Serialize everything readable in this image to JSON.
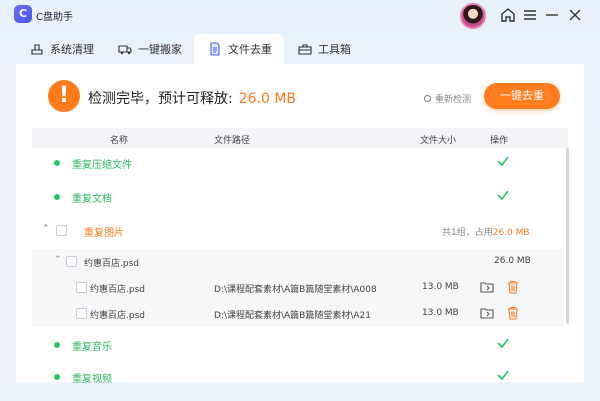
{
  "app": {
    "title": "C盘助手",
    "logo_letter": "C"
  },
  "window_controls": [
    "home-icon",
    "menu-icon",
    "minimize-icon",
    "close-icon"
  ],
  "tabs": [
    {
      "label": "系统清理",
      "icon": "broom-icon",
      "active": false
    },
    {
      "label": "一键搬家",
      "icon": "truck-icon",
      "active": false
    },
    {
      "label": "文件去重",
      "icon": "document-icon",
      "active": true
    },
    {
      "label": "工具箱",
      "icon": "toolbox-icon",
      "active": false
    }
  ],
  "status": {
    "message": "检测完毕，预计可释放:",
    "size": "26.0 MB",
    "rescan_label": "重新检测",
    "action_label": "一键去重"
  },
  "table": {
    "headers": {
      "name": "名称",
      "path": "文件路径",
      "size": "文件大小",
      "action": "操作"
    },
    "categories": [
      {
        "label": "重复压缩文件",
        "state": "clean"
      },
      {
        "label": "重复文档",
        "state": "clean"
      },
      {
        "label": "重复图片",
        "state": "expanded",
        "summary_prefix": "共1组，占用",
        "summary_size": "26.0 MB"
      },
      {
        "label": "重复音乐",
        "state": "clean"
      },
      {
        "label": "重复视频",
        "state": "clean"
      }
    ],
    "group": {
      "name": "约惠百店.psd",
      "size": "26.0 MB"
    },
    "files": [
      {
        "name": "约惠百店.psd",
        "path": "D:\\课程配套素材\\A篇B篇随堂素材\\A008",
        "size": "13.0 MB"
      },
      {
        "name": "约惠百店.psd",
        "path": "D:\\课程配套素材\\A篇B篇随堂素材\\A21",
        "size": "13.0 MB"
      }
    ]
  },
  "colors": {
    "accent": "#ff7a1a",
    "success": "#2cc36b",
    "brand": "#5b5ff0"
  }
}
